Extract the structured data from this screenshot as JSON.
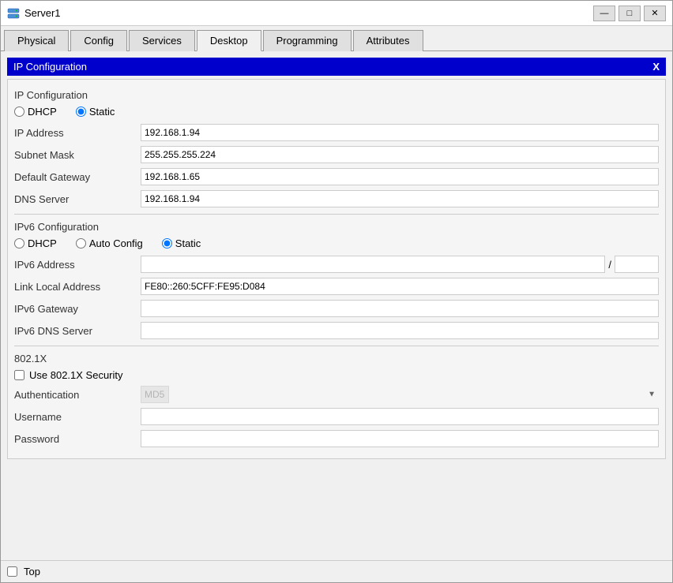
{
  "window": {
    "title": "Server1",
    "icon": "server-icon"
  },
  "titlebar": {
    "minimize_label": "—",
    "maximize_label": "□",
    "close_label": "✕"
  },
  "tabs": [
    {
      "id": "physical",
      "label": "Physical"
    },
    {
      "id": "config",
      "label": "Config"
    },
    {
      "id": "services",
      "label": "Services"
    },
    {
      "id": "desktop",
      "label": "Desktop",
      "active": true
    },
    {
      "id": "programming",
      "label": "Programming"
    },
    {
      "id": "attributes",
      "label": "Attributes"
    }
  ],
  "panel": {
    "title": "IP Configuration",
    "close_label": "X"
  },
  "ip_section": {
    "label": "IP Configuration",
    "dhcp_label": "DHCP",
    "static_label": "Static",
    "static_selected": true,
    "fields": [
      {
        "label": "IP Address",
        "value": "192.168.1.94"
      },
      {
        "label": "Subnet Mask",
        "value": "255.255.255.224"
      },
      {
        "label": "Default Gateway",
        "value": "192.168.1.65"
      },
      {
        "label": "DNS Server",
        "value": "192.168.1.94"
      }
    ]
  },
  "ipv6_section": {
    "label": "IPv6 Configuration",
    "dhcp_label": "DHCP",
    "autoconfig_label": "Auto Config",
    "static_label": "Static",
    "static_selected": true,
    "ipv6_address_label": "IPv6 Address",
    "ipv6_address_value": "",
    "ipv6_slash": "/",
    "ipv6_prefix_value": "",
    "link_local_label": "Link Local Address",
    "link_local_value": "FE80::260:5CFF:FE95:D084",
    "gateway_label": "IPv6 Gateway",
    "gateway_value": "",
    "dns_label": "IPv6 DNS Server",
    "dns_value": ""
  },
  "dot1x_section": {
    "label": "802.1X",
    "checkbox_label": "Use 802.1X Security",
    "auth_label": "Authentication",
    "auth_value": "MD5",
    "username_label": "Username",
    "username_value": "",
    "password_label": "Password",
    "password_value": ""
  },
  "bottom": {
    "checkbox_label": "Top"
  }
}
